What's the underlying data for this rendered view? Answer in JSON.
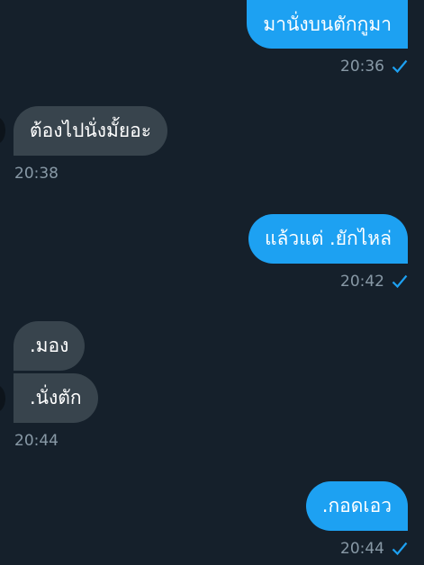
{
  "messages": [
    {
      "direction": "out",
      "text": "มานั่งบนตักกูมา",
      "time": "20:36",
      "read": true
    },
    {
      "direction": "in",
      "text": "ต้องไปนั่งมั้ยอะ",
      "time": "20:38"
    },
    {
      "direction": "out",
      "text": "แล้วแต่ .ยักไหล่",
      "time": "20:42",
      "read": true
    },
    {
      "direction": "in",
      "text": ".มอง"
    },
    {
      "direction": "in",
      "text": ".นั่งตัก",
      "time": "20:44"
    },
    {
      "direction": "out",
      "text": ".กอดเอว",
      "time": "20:44",
      "read": true
    }
  ],
  "colors": {
    "background": "#15202b",
    "outgoing_bubble": "#1da1f2",
    "incoming_bubble": "#38444d",
    "timestamp": "#8899a6",
    "read_check": "#1da1f2"
  },
  "icons": {
    "read_receipt": "checkmark-icon"
  }
}
